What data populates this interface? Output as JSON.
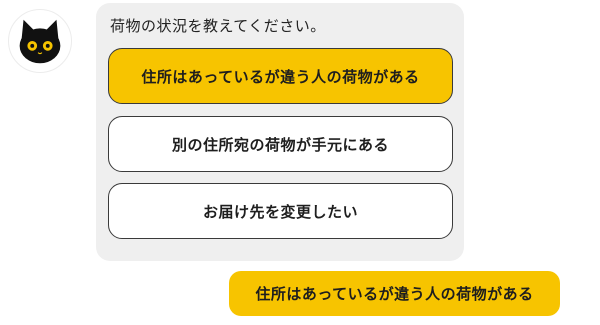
{
  "bot": {
    "avatar_icon": "black-cat-icon",
    "question": "荷物の状況を教えてください。",
    "choices": [
      {
        "label": "住所はあっているが違う人の荷物がある",
        "selected": true
      },
      {
        "label": "別の住所宛の荷物が手元にある",
        "selected": false
      },
      {
        "label": "お届け先を変更したい",
        "selected": false
      }
    ]
  },
  "user": {
    "reply": "住所はあっているが違う人の荷物がある"
  },
  "colors": {
    "accent": "#f7c400",
    "card_bg": "#efefef",
    "border": "#3a3a3a"
  }
}
